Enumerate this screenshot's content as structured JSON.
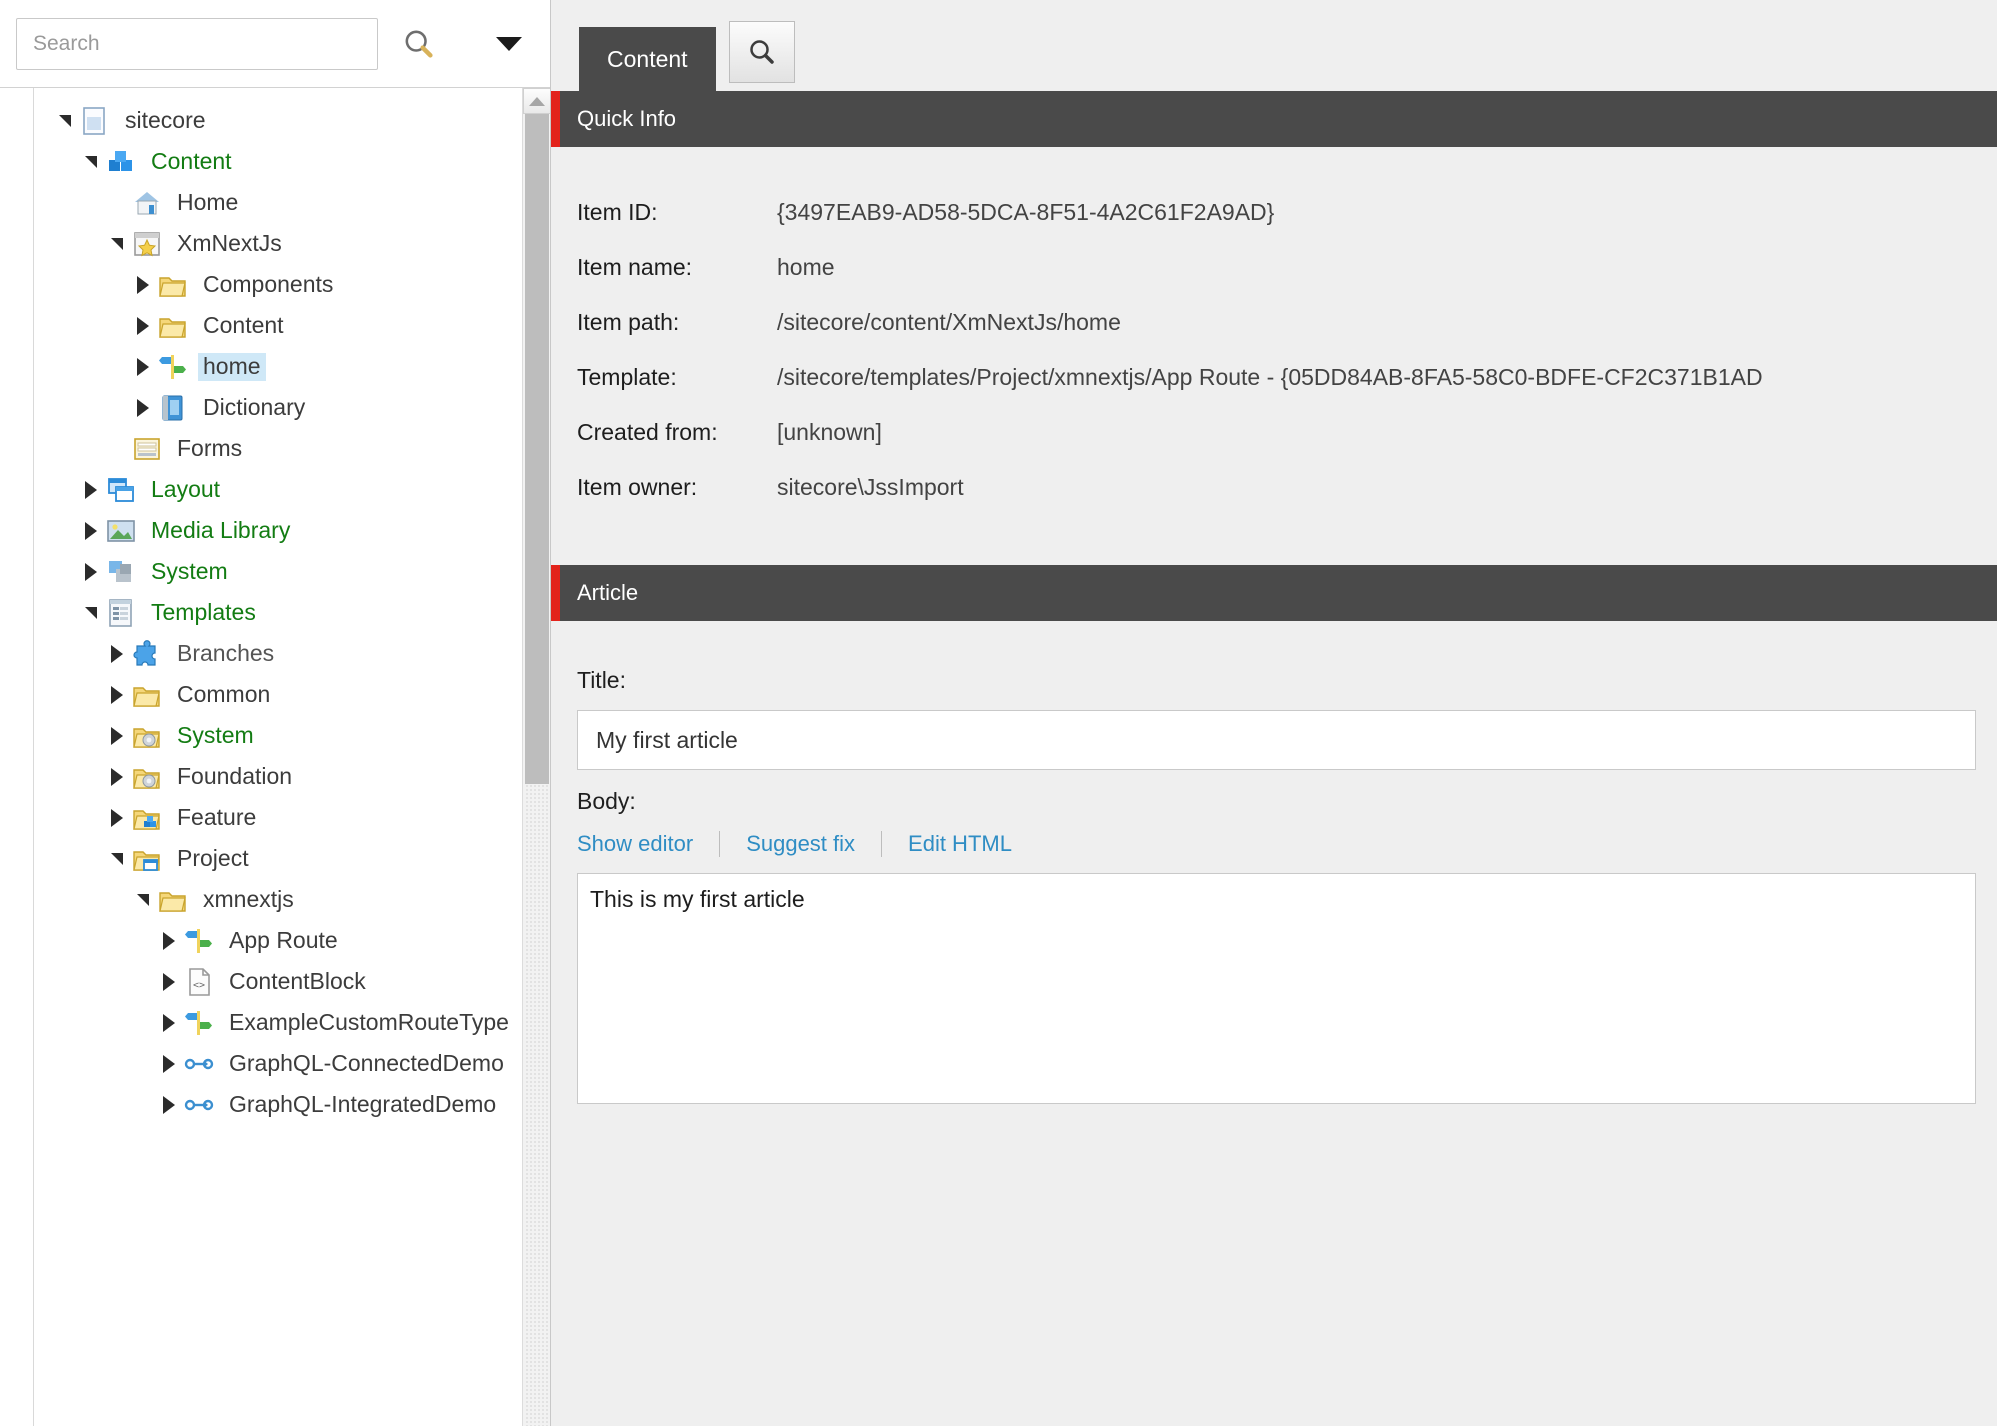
{
  "search": {
    "placeholder": "Search",
    "go_icon": "search-icon",
    "caret_icon": "chevron-down-icon"
  },
  "tree": {
    "nodes": [
      {
        "label": "sitecore",
        "indent": 0,
        "twisty": "down",
        "icon": "document-icon",
        "color": "dark",
        "selected": false
      },
      {
        "label": "Content",
        "indent": 1,
        "twisty": "down",
        "icon": "content-cubes-icon",
        "color": "green",
        "selected": false
      },
      {
        "label": "Home",
        "indent": 2,
        "twisty": "none",
        "icon": "home-icon",
        "color": "dark",
        "selected": false
      },
      {
        "label": "XmNextJs",
        "indent": 2,
        "twisty": "down",
        "icon": "site-star-icon",
        "color": "dark",
        "selected": false
      },
      {
        "label": "Components",
        "indent": 3,
        "twisty": "right",
        "icon": "folder-icon",
        "color": "dark",
        "selected": false
      },
      {
        "label": "Content",
        "indent": 3,
        "twisty": "right",
        "icon": "folder-icon",
        "color": "dark",
        "selected": false
      },
      {
        "label": "home",
        "indent": 3,
        "twisty": "right",
        "icon": "route-signpost-icon",
        "color": "dark",
        "selected": true
      },
      {
        "label": "Dictionary",
        "indent": 3,
        "twisty": "right",
        "icon": "book-icon",
        "color": "dark",
        "selected": false
      },
      {
        "label": "Forms",
        "indent": 2,
        "twisty": "none",
        "icon": "forms-icon",
        "color": "dark",
        "selected": false
      },
      {
        "label": "Layout",
        "indent": 1,
        "twisty": "right",
        "icon": "layout-windows-icon",
        "color": "green",
        "selected": false
      },
      {
        "label": "Media Library",
        "indent": 1,
        "twisty": "right",
        "icon": "media-image-icon",
        "color": "green",
        "selected": false
      },
      {
        "label": "System",
        "indent": 1,
        "twisty": "right",
        "icon": "system-cubes-icon",
        "color": "green",
        "selected": false
      },
      {
        "label": "Templates",
        "indent": 1,
        "twisty": "down",
        "icon": "templates-list-icon",
        "color": "green",
        "selected": false
      },
      {
        "label": "Branches",
        "indent": 2,
        "twisty": "right",
        "icon": "puzzle-icon",
        "color": "gray",
        "selected": false
      },
      {
        "label": "Common",
        "indent": 2,
        "twisty": "right",
        "icon": "folder-icon",
        "color": "dark",
        "selected": false
      },
      {
        "label": "System",
        "indent": 2,
        "twisty": "right",
        "icon": "folder-gear-icon",
        "color": "green",
        "selected": false
      },
      {
        "label": "Foundation",
        "indent": 2,
        "twisty": "right",
        "icon": "folder-gear-icon",
        "color": "dark",
        "selected": false
      },
      {
        "label": "Feature",
        "indent": 2,
        "twisty": "right",
        "icon": "folder-cubes-icon",
        "color": "dark",
        "selected": false
      },
      {
        "label": "Project",
        "indent": 2,
        "twisty": "down",
        "icon": "folder-window-icon",
        "color": "dark",
        "selected": false
      },
      {
        "label": "xmnextjs",
        "indent": 3,
        "twisty": "down",
        "icon": "folder-icon",
        "color": "dark",
        "selected": false
      },
      {
        "label": "App Route",
        "indent": 4,
        "twisty": "right",
        "icon": "route-signpost-icon",
        "color": "dark",
        "selected": false
      },
      {
        "label": "ContentBlock",
        "indent": 4,
        "twisty": "right",
        "icon": "code-doc-icon",
        "color": "dark",
        "selected": false
      },
      {
        "label": "ExampleCustomRouteType",
        "indent": 4,
        "twisty": "right",
        "icon": "route-signpost-icon",
        "color": "dark",
        "selected": false
      },
      {
        "label": "GraphQL-ConnectedDemo",
        "indent": 4,
        "twisty": "right",
        "icon": "graphql-link-icon",
        "color": "dark",
        "selected": false
      },
      {
        "label": "GraphQL-IntegratedDemo",
        "indent": 4,
        "twisty": "right",
        "icon": "graphql-link-icon",
        "color": "dark",
        "selected": false
      }
    ]
  },
  "tabs": {
    "items": [
      {
        "label": "Content",
        "active": true
      }
    ],
    "search_button_icon": "search-icon"
  },
  "quick_info": {
    "header": "Quick Info",
    "rows": [
      {
        "label": "Item ID:",
        "value": "{3497EAB9-AD58-5DCA-8F51-4A2C61F2A9AD}"
      },
      {
        "label": "Item name:",
        "value": "home"
      },
      {
        "label": "Item path:",
        "value": "/sitecore/content/XmNextJs/home"
      },
      {
        "label": "Template:",
        "value": "/sitecore/templates/Project/xmnextjs/App Route - {05DD84AB-8FA5-58C0-BDFE-CF2C371B1AD"
      },
      {
        "label": "Created from:",
        "value": "[unknown]"
      },
      {
        "label": "Item owner:",
        "value": "sitecore\\JssImport"
      }
    ]
  },
  "article": {
    "header": "Article",
    "title_label": "Title:",
    "title_value": "My first article",
    "body_label": "Body:",
    "body_links": [
      {
        "label": "Show editor"
      },
      {
        "label": "Suggest fix"
      },
      {
        "label": "Edit HTML"
      }
    ],
    "body_value": "This is my first article"
  },
  "colors": {
    "accent_red": "#e3231b",
    "section_dark": "#4a4a4a",
    "link_blue": "#2f8dc4",
    "tree_green": "#137c13",
    "selection_blue": "#cfe8f7"
  }
}
